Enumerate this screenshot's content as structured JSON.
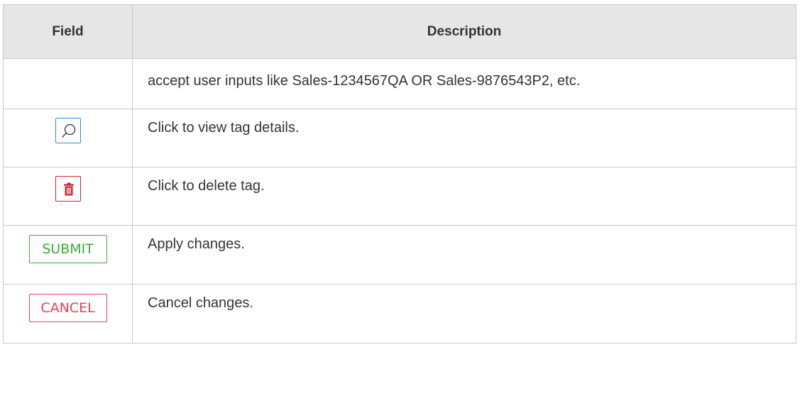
{
  "table": {
    "headers": {
      "field": "Field",
      "description": "Description"
    },
    "rows": [
      {
        "field": "",
        "description": "accept user inputs like Sales-1234567QA OR Sales-9876543P2, etc."
      },
      {
        "field_icon": "search-icon",
        "description": "Click to view tag details."
      },
      {
        "field_icon": "trash-icon",
        "description": "Click to delete tag."
      },
      {
        "field_button": "SUBMIT",
        "description": "Apply changes."
      },
      {
        "field_button": "CANCEL",
        "description": "Cancel changes."
      }
    ]
  },
  "colors": {
    "header_bg": "#e6e6e6",
    "border": "#c8c8c8",
    "search_blue": "#2a8fd0",
    "trash_red": "#c8232c",
    "submit_green": "#3aaa35",
    "cancel_red": "#e8405a"
  }
}
